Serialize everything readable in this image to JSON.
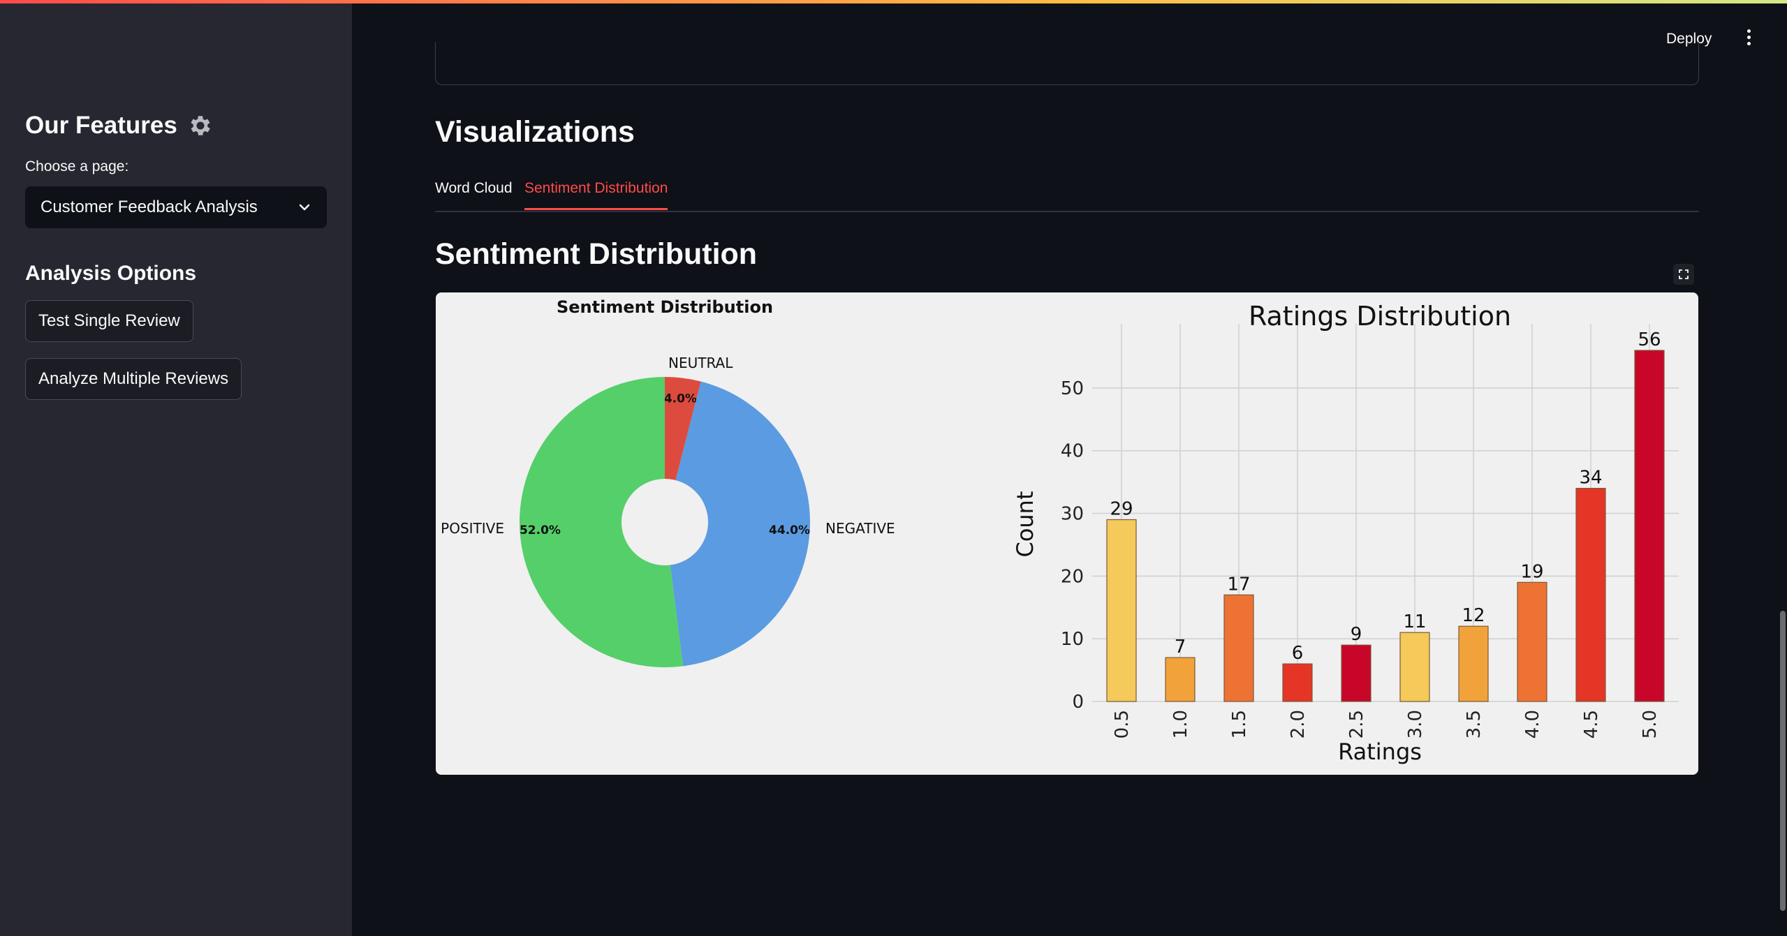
{
  "header": {
    "deploy_label": "Deploy"
  },
  "sidebar": {
    "title": "Our Features",
    "page_label": "Choose a page:",
    "page_selected": "Customer Feedback Analysis",
    "options_title": "Analysis Options",
    "buttons": [
      "Test Single Review",
      "Analyze Multiple Reviews"
    ]
  },
  "main": {
    "visualizations_title": "Visualizations",
    "tabs": [
      {
        "label": "Word Cloud",
        "active": false
      },
      {
        "label": "Sentiment Distribution",
        "active": true
      }
    ],
    "section_title": "Sentiment Distribution"
  },
  "colors": {
    "accent": "#ff4b4b",
    "positive": "#55cf6a",
    "negative": "#5b9be1",
    "neutral": "#dd4b3e"
  },
  "icons": {
    "title_icon": "gear-icon",
    "select_icon": "chevron-down-icon",
    "menu": "kebab-menu-icon",
    "expand": "fullscreen-icon"
  },
  "chart_data": [
    {
      "type": "pie",
      "title": "Sentiment Distribution",
      "donut": true,
      "slices": [
        {
          "label": "NEUTRAL",
          "value": 4.0,
          "pct_label": "4.0%",
          "color": "#dd4b3e"
        },
        {
          "label": "NEGATIVE",
          "value": 44.0,
          "pct_label": "44.0%",
          "color": "#5b9be1"
        },
        {
          "label": "POSITIVE",
          "value": 52.0,
          "pct_label": "52.0%",
          "color": "#55cf6a"
        }
      ]
    },
    {
      "type": "bar",
      "title": "Ratings Distribution",
      "xlabel": "Ratings",
      "ylabel": "Count",
      "categories": [
        "0.5",
        "1.0",
        "1.5",
        "2.0",
        "2.5",
        "3.0",
        "3.5",
        "4.0",
        "4.5",
        "5.0"
      ],
      "values": [
        29,
        7,
        17,
        6,
        9,
        11,
        12,
        19,
        34,
        56
      ],
      "bar_colors": [
        "#f5c95a",
        "#f2a23b",
        "#ee7233",
        "#e53527",
        "#c8062a",
        "#f5c95a",
        "#f2a23b",
        "#ee7233",
        "#e53527",
        "#c8062a"
      ],
      "yticks": [
        0,
        10,
        20,
        30,
        40,
        50
      ],
      "ylim": [
        0,
        58
      ],
      "grid": true
    }
  ]
}
